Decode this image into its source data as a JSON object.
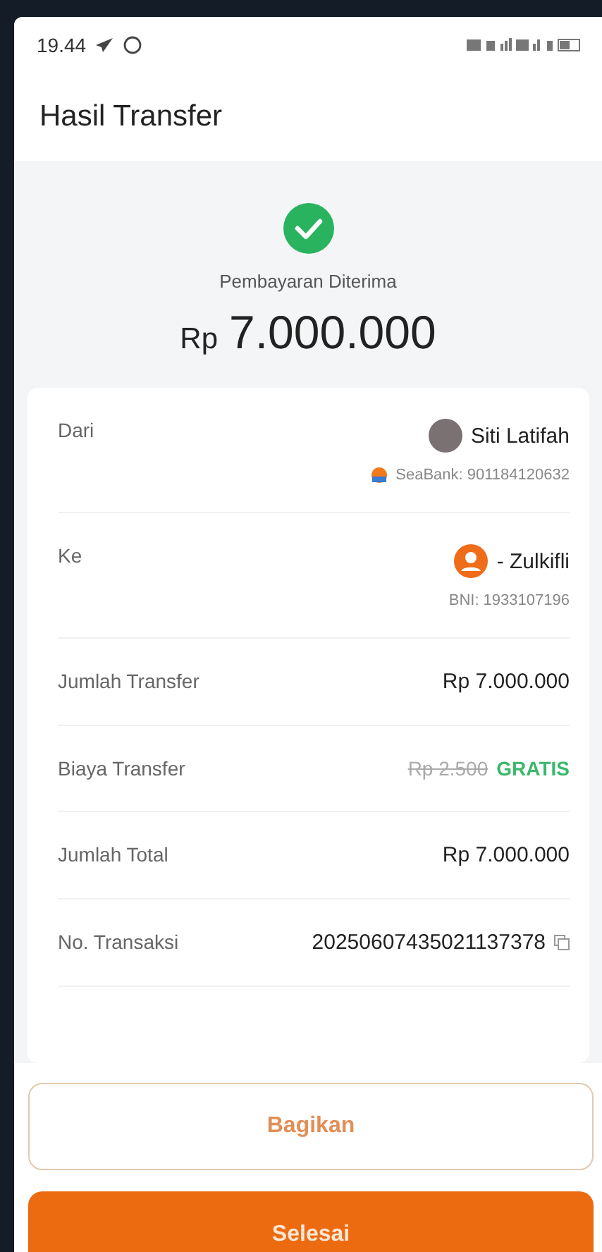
{
  "status_bar": {
    "time": "19.44"
  },
  "header": {
    "title": "Hasil Transfer"
  },
  "result": {
    "status": "Pembayaran Diterima",
    "currency": "Rp",
    "amount": "7.000.000"
  },
  "details": [
    {
      "kind": "sender",
      "label": "Dari",
      "name": "Siti Latifah",
      "account": "SeaBank: 901184120632"
    },
    {
      "kind": "recipient",
      "label": "Ke",
      "name": "- Zulkifli",
      "account": "BNI: 1933107196"
    },
    {
      "kind": "plain",
      "label": "Jumlah Transfer",
      "value": "Rp 7.000.000"
    },
    {
      "kind": "fee",
      "label": "Biaya Transfer",
      "old_value": "Rp 2.500",
      "value": "GRATIS"
    },
    {
      "kind": "plain",
      "label": "Jumlah Total",
      "value": "Rp 7.000.000"
    },
    {
      "kind": "copy",
      "label": "No. Transaksi",
      "value": "20250607435021137378"
    }
  ],
  "buttons": [
    {
      "label": "Bagikan",
      "kind": "outline"
    },
    {
      "label": "Selesai",
      "kind": "primary"
    }
  ]
}
